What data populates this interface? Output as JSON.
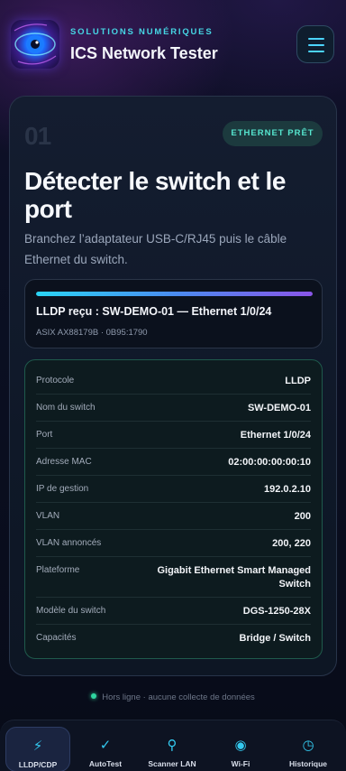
{
  "header": {
    "kicker": "Solutions numériques",
    "title": "ICS Network Tester",
    "logo_icon": "eye-logo-icon",
    "menu_icon": "hamburger-menu-icon"
  },
  "step": {
    "number": "01",
    "badge": "ETHERNET PRÊT",
    "title": "Détecter le switch et le port",
    "description": "Branchez l’adaptateur USB-C/RJ45 puis le câble Ethernet du switch."
  },
  "lldp": {
    "progress_percent": 100,
    "status": "LLDP reçu : SW-DEMO-01 — Ethernet 1/0/24",
    "adapter": "ASIX AX88179B · 0B95:1790"
  },
  "details": [
    {
      "label": "Protocole",
      "value": "LLDP"
    },
    {
      "label": "Nom du switch",
      "value": "SW-DEMO-01"
    },
    {
      "label": "Port",
      "value": "Ethernet 1/0/24"
    },
    {
      "label": "Adresse MAC",
      "value": "02:00:00:00:00:10"
    },
    {
      "label": "IP de gestion",
      "value": "192.0.2.10"
    },
    {
      "label": "VLAN",
      "value": "200"
    },
    {
      "label": "VLAN annoncés",
      "value": "200, 220"
    },
    {
      "label": "Plateforme",
      "value": "Gigabit Ethernet Smart Managed Switch"
    },
    {
      "label": "Modèle du switch",
      "value": "DGS-1250-28X"
    },
    {
      "label": "Capacités",
      "value": "Bridge / Switch"
    }
  ],
  "footnote": "Hors ligne · aucune collecte de données",
  "nav": [
    {
      "label": "LLDP/CDP",
      "icon": "lightning-icon",
      "glyph": "⚡",
      "active": true
    },
    {
      "label": "AutoTest",
      "icon": "checkmark-icon",
      "glyph": "✓",
      "active": false
    },
    {
      "label": "Scanner LAN",
      "icon": "search-icon",
      "glyph": "⚲",
      "active": false
    },
    {
      "label": "Wi-Fi",
      "icon": "wifi-icon",
      "glyph": "◉",
      "active": false
    },
    {
      "label": "Historique",
      "icon": "clock-icon",
      "glyph": "◷",
      "active": false
    }
  ],
  "colors": {
    "accent": "#33c9ef",
    "ready": "#56e6cf",
    "online_dot": "#2fd6a0"
  }
}
